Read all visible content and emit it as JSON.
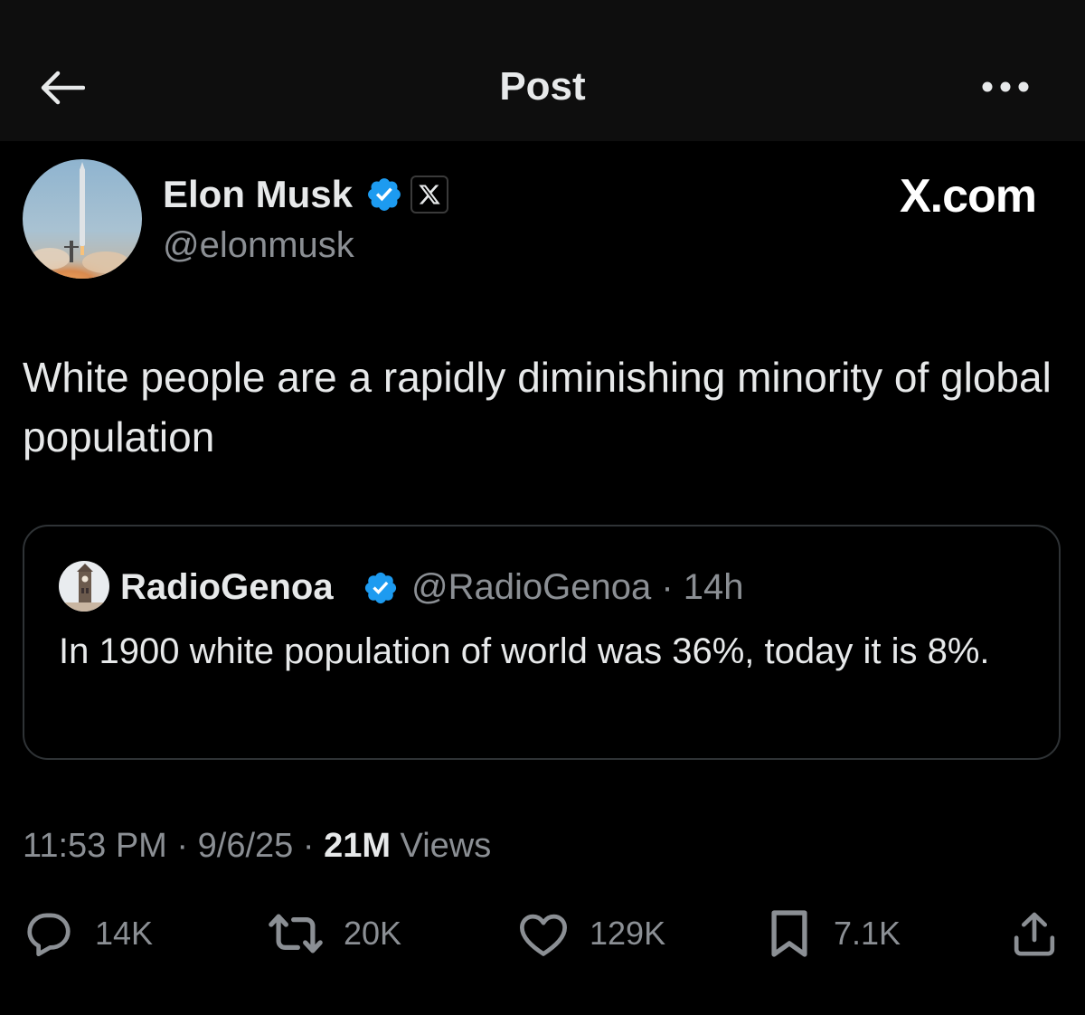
{
  "header": {
    "title": "Post",
    "back_icon": "arrow-left-icon",
    "more_icon": "more-horizontal-icon"
  },
  "author": {
    "name": "Elon Musk",
    "handle": "@elonmusk",
    "verified_color": "#1d9bf0",
    "affiliate_badge_icon": "x-logo-icon"
  },
  "watermark": "X.com",
  "post": {
    "text": "White people are a rapidly diminishing minority of global population"
  },
  "quote": {
    "name": "RadioGenoa",
    "handle": "@RadioGenoa",
    "separator": "·",
    "time": "14h",
    "text": "In 1900 white population of world was 36%, today it is 8%."
  },
  "meta": {
    "time": "11:53 PM",
    "separator": "·",
    "date": "9/6/25",
    "views_count": "21M",
    "views_label": "Views"
  },
  "actions": {
    "replies": "14K",
    "reposts": "20K",
    "likes": "129K",
    "bookmarks": "7.1K"
  },
  "colors": {
    "background": "#000000",
    "header_background": "#0e0e0e",
    "text_primary": "#e7e9ea",
    "text_secondary": "#8b8f94",
    "verified": "#1d9bf0",
    "border": "#2f3336"
  }
}
